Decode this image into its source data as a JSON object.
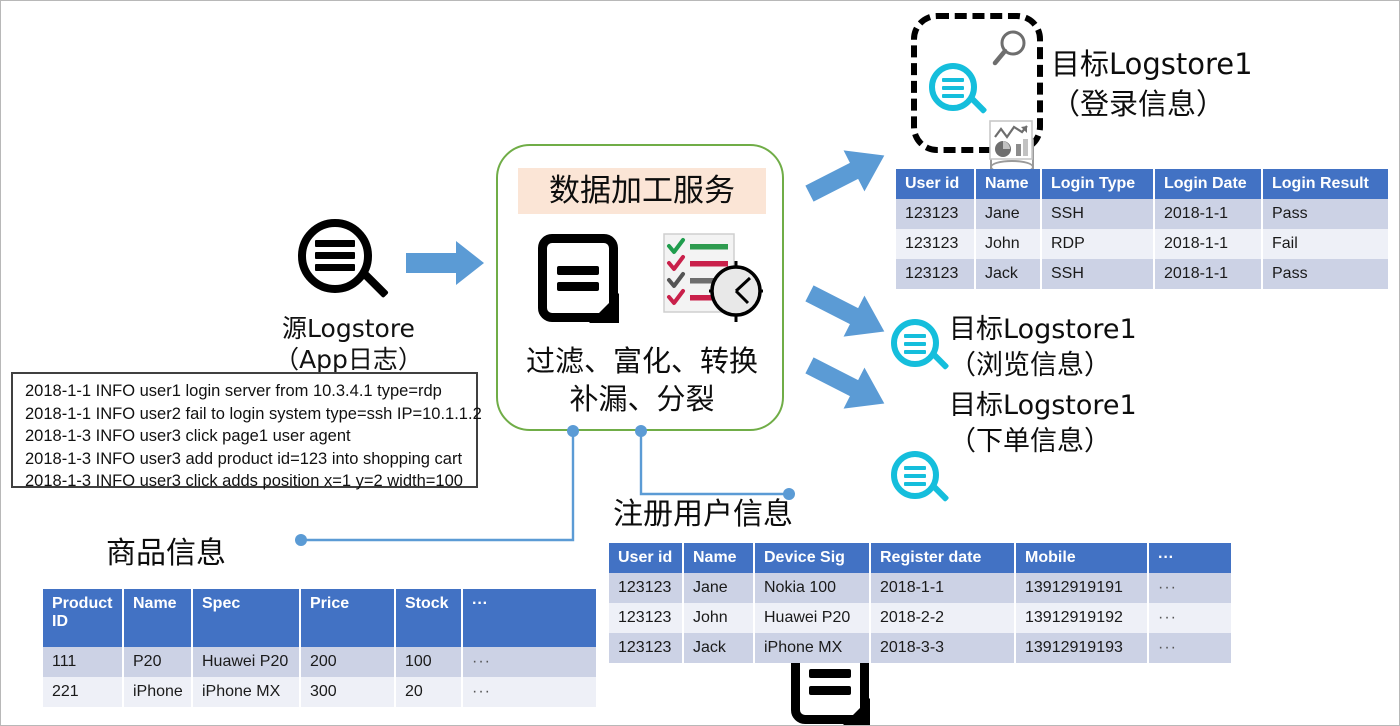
{
  "colors": {
    "accent_blue": "#4272C4",
    "arrow_blue": "#5B9BD5",
    "cyan": "#15BEDC",
    "green_border": "#70AD47",
    "title_banner_bg": "#FBE5D6",
    "row_odd": "#ccd2e5",
    "row_even": "#eef0f7"
  },
  "source": {
    "icon": "magnifier-list-icon",
    "label_line1": "源Logstore",
    "label_line2": "（App日志）"
  },
  "log_sample": {
    "lines": [
      "2018-1-1 INFO user1 login server from 10.3.4.1 type=rdp",
      "2018-1-1 INFO user2 fail to login system type=ssh IP=10.1.1.2",
      "2018-1-3 INFO user3 click page1 user agent",
      "2018-1-3 INFO user3 add product id=123 into shopping cart",
      "2018-1-3 INFO user3 click adds position x=1 y=2 width=100"
    ]
  },
  "service": {
    "title": "数据加工服务",
    "desc_line1": "过滤、富化、转换",
    "desc_line2": "补漏、分裂",
    "icons": [
      "document-icon",
      "checklist-clock-icon"
    ]
  },
  "capability_box": {
    "icons": [
      "search-logstore-icon",
      "magnifier-icon",
      "database-cylinder-icon",
      "analytics-chart-icon"
    ]
  },
  "targets": [
    {
      "name": "目标Logstore1",
      "sub": "（登录信息）",
      "icon": "search-logstore-icon"
    },
    {
      "name": "目标Logstore1",
      "sub": "（浏览信息）",
      "icon": "search-logstore-icon"
    },
    {
      "name": "目标Logstore1",
      "sub": "（下单信息）",
      "icon": "search-logstore-icon"
    }
  ],
  "login_table": {
    "headers": [
      "User id",
      "Name",
      "Login Type",
      "Login Date",
      "Login Result"
    ],
    "rows": [
      [
        "123123",
        "Jane",
        "SSH",
        "2018-1-1",
        "Pass"
      ],
      [
        "123123",
        "John",
        "RDP",
        "2018-1-1",
        "Fail"
      ],
      [
        "123123",
        "Jack",
        "SSH",
        "2018-1-1",
        "Pass"
      ]
    ]
  },
  "product_source": {
    "label": "商品信息",
    "icon": "document-icon"
  },
  "product_table": {
    "headers": [
      "Product ID",
      "Name",
      "Spec",
      "Price",
      "Stock",
      "···"
    ],
    "rows": [
      [
        "111",
        "P20",
        "Huawei P20",
        "200",
        "100",
        "···"
      ],
      [
        "221",
        "iPhone",
        "iPhone MX",
        "300",
        "20",
        "···"
      ]
    ]
  },
  "user_source": {
    "label": "注册用户信息",
    "icon": "document-icon"
  },
  "user_table": {
    "headers": [
      "User id",
      "Name",
      "Device Sig",
      "Register date",
      "Mobile",
      "···"
    ],
    "rows": [
      [
        "123123",
        "Jane",
        "Nokia 100",
        "2018-1-1",
        "13912919191",
        "···"
      ],
      [
        "123123",
        "John",
        "Huawei P20",
        "2018-2-2",
        "13912919192",
        "···"
      ],
      [
        "123123",
        "Jack",
        "iPhone MX",
        "2018-3-3",
        "13912919193",
        "···"
      ]
    ]
  }
}
